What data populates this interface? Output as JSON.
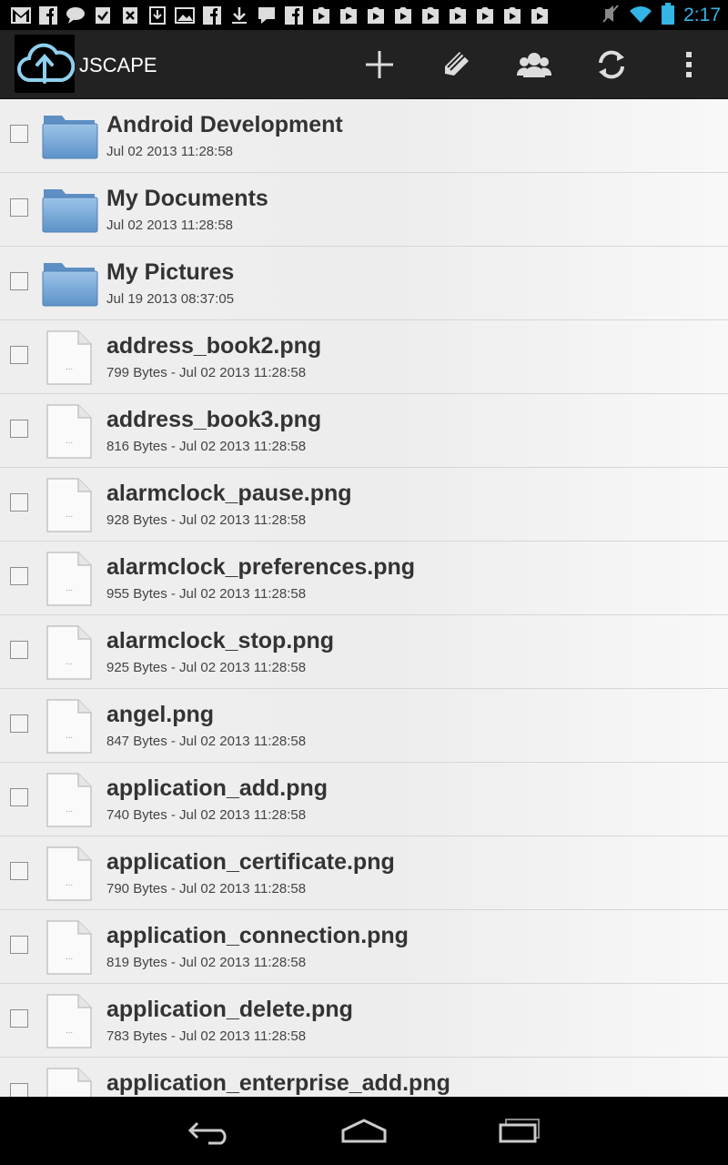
{
  "status_bar": {
    "time": "2:17",
    "left_icons": [
      "gmail-icon",
      "facebook-icon",
      "chat-icon",
      "task-check-icon",
      "x-app-icon",
      "download-box-icon",
      "gallery-icon",
      "facebook-icon",
      "download-icon",
      "message-icon",
      "facebook-icon",
      "play-icon",
      "play-icon",
      "play-icon",
      "play-icon",
      "play-icon",
      "play-icon",
      "play-icon",
      "play-icon",
      "play-icon"
    ]
  },
  "action_bar": {
    "title": "JSCAPE",
    "actions": [
      "add-icon",
      "rename-icon",
      "share-icon",
      "refresh-icon",
      "overflow-menu-icon"
    ]
  },
  "files": [
    {
      "type": "folder",
      "name": "Android Development",
      "meta": "Jul 02 2013 11:28:58"
    },
    {
      "type": "folder",
      "name": "My Documents",
      "meta": "Jul 02 2013 11:28:58"
    },
    {
      "type": "folder",
      "name": "My Pictures",
      "meta": "Jul 19 2013 08:37:05"
    },
    {
      "type": "file",
      "name": "address_book2.png",
      "meta": "799 Bytes - Jul 02 2013 11:28:58"
    },
    {
      "type": "file",
      "name": "address_book3.png",
      "meta": "816 Bytes - Jul 02 2013 11:28:58"
    },
    {
      "type": "file",
      "name": "alarmclock_pause.png",
      "meta": "928 Bytes - Jul 02 2013 11:28:58"
    },
    {
      "type": "file",
      "name": "alarmclock_preferences.png",
      "meta": "955 Bytes - Jul 02 2013 11:28:58"
    },
    {
      "type": "file",
      "name": "alarmclock_stop.png",
      "meta": "925 Bytes - Jul 02 2013 11:28:58"
    },
    {
      "type": "file",
      "name": "angel.png",
      "meta": "847 Bytes - Jul 02 2013 11:28:58"
    },
    {
      "type": "file",
      "name": "application_add.png",
      "meta": "740 Bytes - Jul 02 2013 11:28:58"
    },
    {
      "type": "file",
      "name": "application_certificate.png",
      "meta": "790 Bytes - Jul 02 2013 11:28:58"
    },
    {
      "type": "file",
      "name": "application_connection.png",
      "meta": "819 Bytes - Jul 02 2013 11:28:58"
    },
    {
      "type": "file",
      "name": "application_delete.png",
      "meta": "783 Bytes - Jul 02 2013 11:28:58"
    },
    {
      "type": "file",
      "name": "application_enterprise_add.png",
      "meta": ""
    }
  ],
  "nav_bar": [
    "back-icon",
    "home-icon",
    "recent-apps-icon"
  ],
  "colors": {
    "accent": "#33b5e5",
    "folder": "#6fa3d6",
    "action_bar": "#222222"
  }
}
